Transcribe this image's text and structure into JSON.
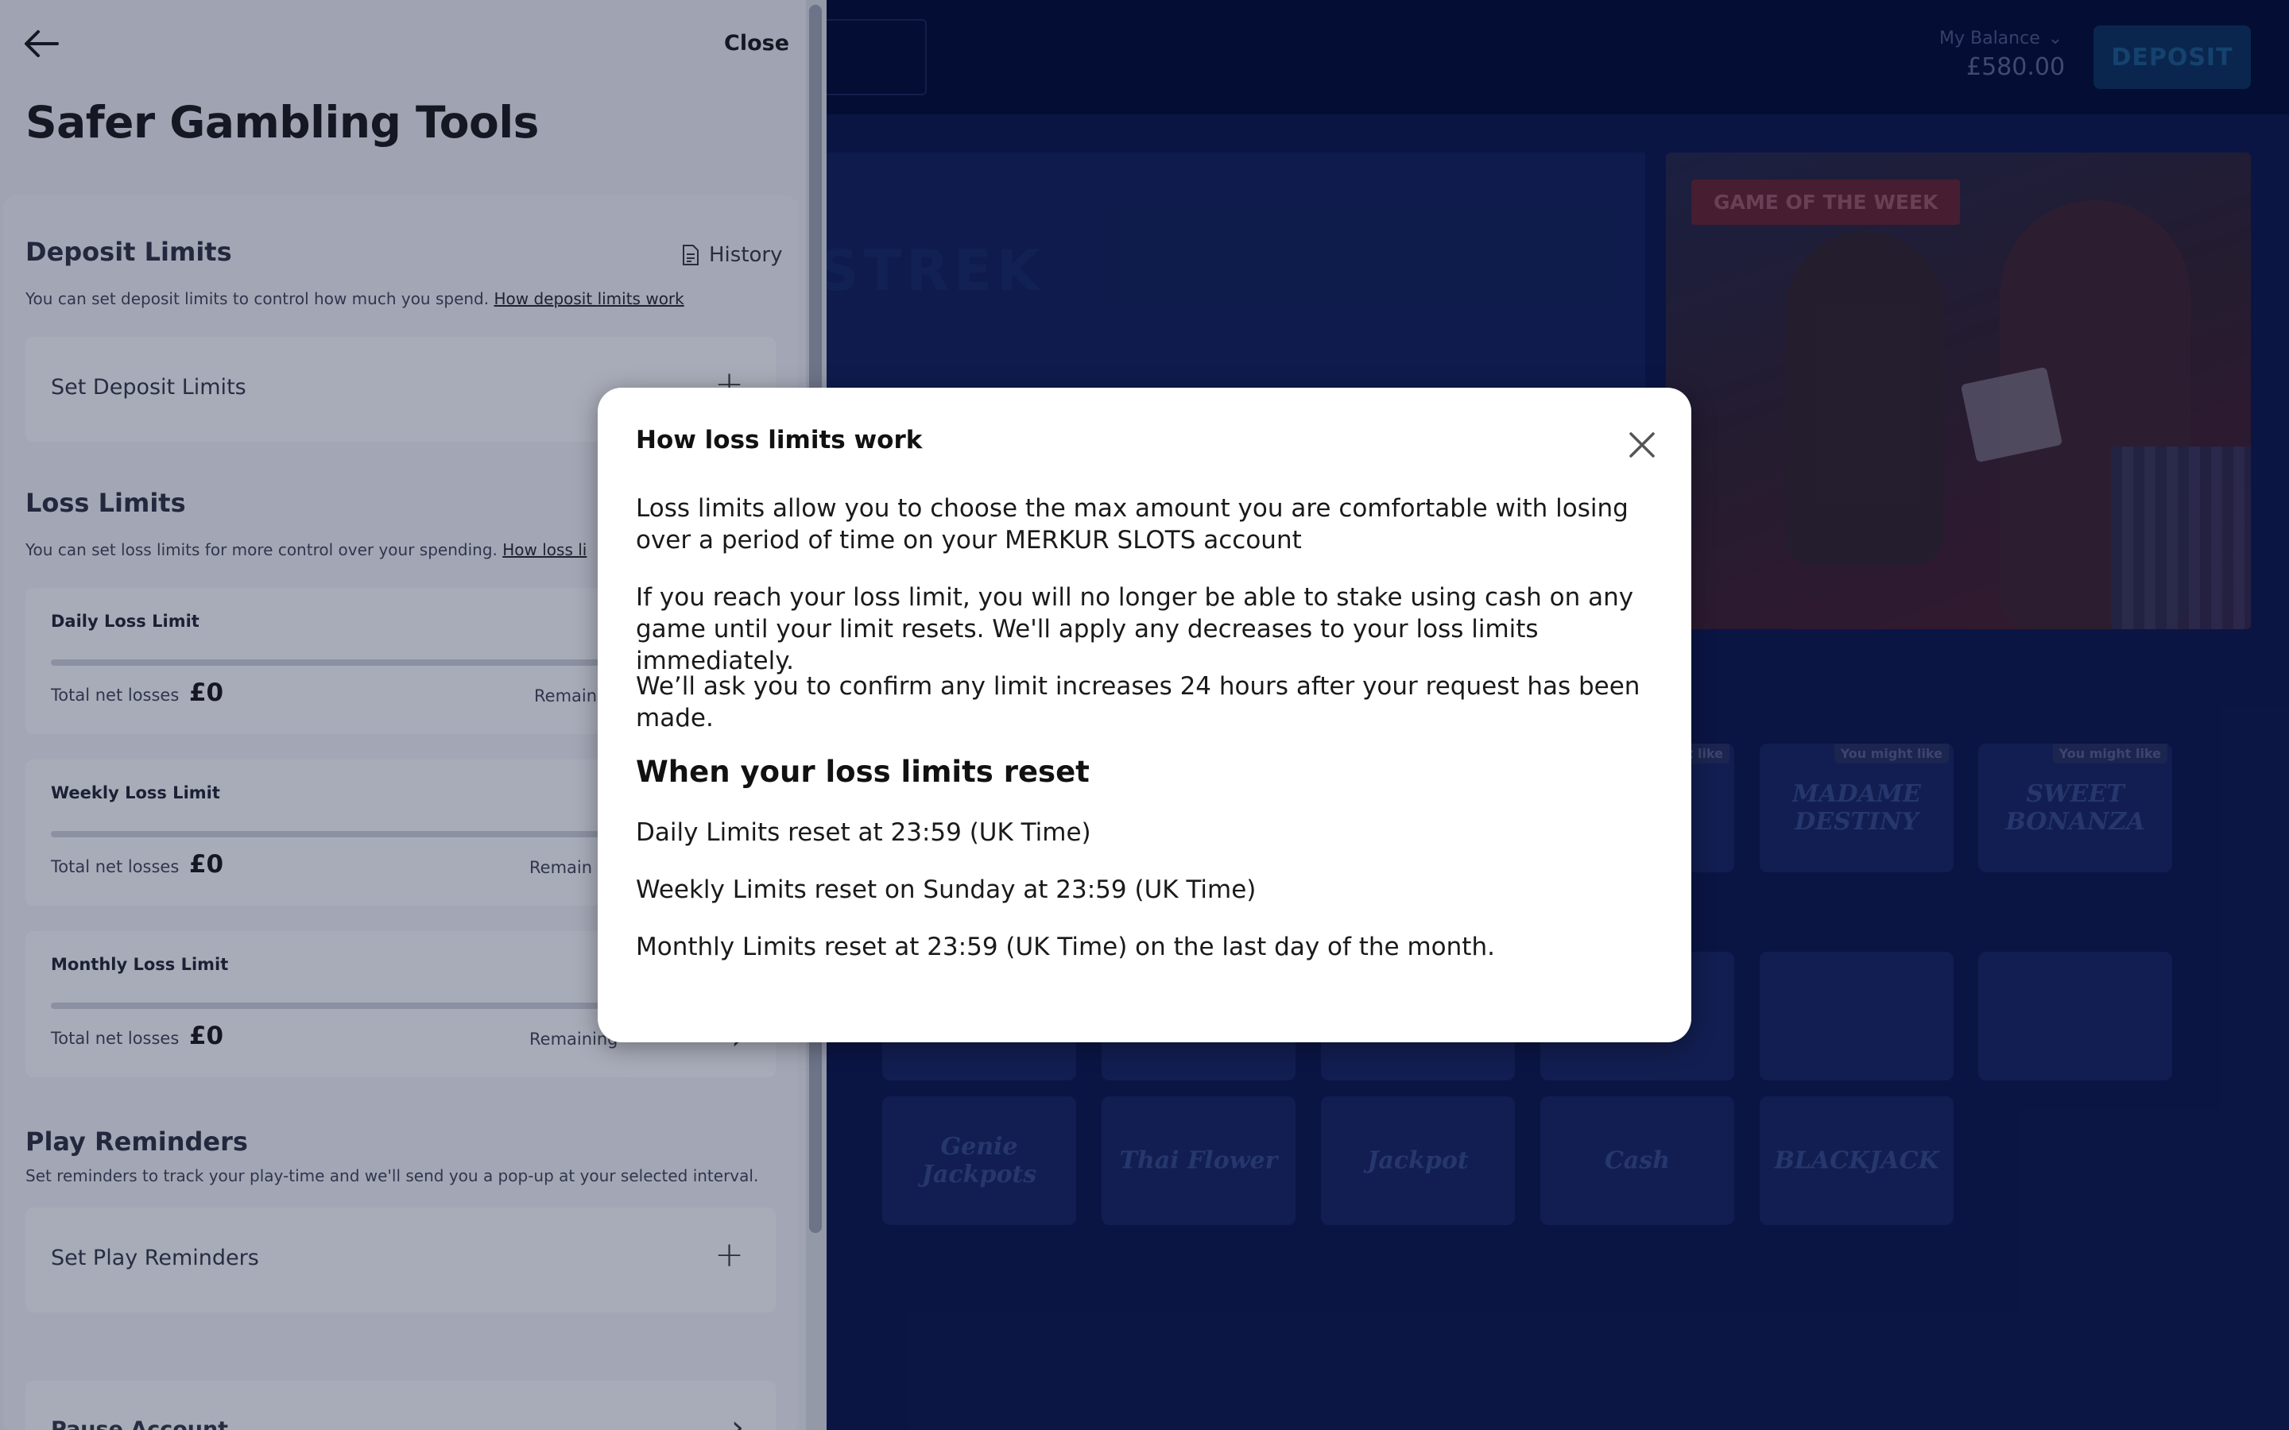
{
  "colors": {
    "accent": "#0b3b6e",
    "navy": "#000d3d",
    "drawer_bg": "#e9ebf0"
  },
  "header": {
    "balance_label": "My Balance",
    "balance_amount": "£580.00",
    "deposit_label": "DEPOSIT"
  },
  "hero": {
    "faded_text": "STREK"
  },
  "promo": {
    "badge": "GAME OF THE WEEK"
  },
  "games": {
    "tag": "You might like",
    "row1": [
      "MADAME DESTINY",
      "SWEET BONANZA"
    ],
    "row3": [
      "Genie Jackpots",
      "Thai Flower",
      "Jackpot",
      "Cash",
      "BLACKJACK"
    ]
  },
  "drawer": {
    "back_icon": "arrow-left-icon",
    "close_label": "Close",
    "title": "Safer Gambling Tools",
    "deposit": {
      "title": "Deposit Limits",
      "history_label": "History",
      "desc": "You can set deposit limits to control how much you spend.",
      "link": "How deposit limits work",
      "set_label": "Set Deposit Limits"
    },
    "loss": {
      "title": "Loss Limits",
      "desc": "You can set loss limits for more control over your spending.",
      "link": "How loss li",
      "cards": [
        {
          "title": "Daily Loss Limit",
          "net_label": "Total net losses",
          "net_value": "£0",
          "remaining": "Remain"
        },
        {
          "title": "Weekly Loss Limit",
          "net_label": "Total net losses",
          "net_value": "£0",
          "remaining": "Remain"
        },
        {
          "title": "Monthly Loss Limit",
          "net_label": "Total net losses",
          "net_value": "£0",
          "remaining": "Remaining"
        }
      ]
    },
    "reminders": {
      "title": "Play Reminders",
      "desc": "Set reminders to track your play-time and we'll send you a pop-up at your selected interval.",
      "set_label": "Set Play Reminders"
    },
    "pause": {
      "label": "Pause Account"
    }
  },
  "modal": {
    "title": "How loss limits work",
    "p1": "Loss limits allow you to choose the max amount you are comfortable with losing over a period of time on your MERKUR SLOTS account",
    "p2": "If you reach your loss limit, you will no longer be able to stake using cash on any game until your limit resets. We'll apply any decreases to your loss limits immediately.",
    "p3": "We’ll ask you to confirm any limit increases 24 hours after your request has been made.",
    "subtitle": "When your loss limits reset",
    "r1": "Daily Limits reset at 23:59 (UK Time)",
    "r2": "Weekly Limits reset on Sunday at 23:59 (UK Time)",
    "r3": "Monthly Limits reset at 23:59 (UK Time) on the last day of the month."
  }
}
